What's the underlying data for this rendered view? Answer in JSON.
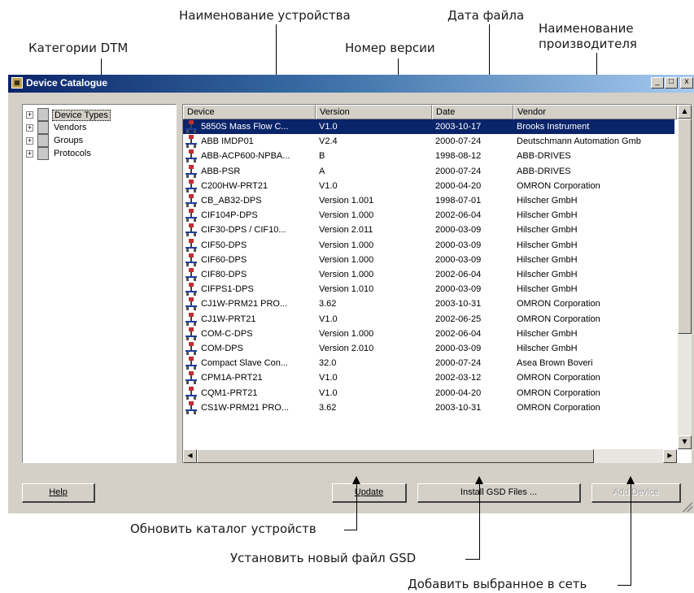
{
  "callouts": {
    "device_name": "Наименование устройства",
    "file_date": "Дата файла",
    "manufacturer_line1": "Наименование",
    "manufacturer_line2": "производителя",
    "dtm_categories": "Категории DTM",
    "version_number": "Номер версии",
    "update_catalog": "Обновить каталог устройств",
    "install_gsd": "Установить новый файл GSD",
    "add_selected": "Добавить выбранное в сеть"
  },
  "window": {
    "title": "Device Catalogue",
    "minimize": "_",
    "maximize": "□",
    "close": "x"
  },
  "tree": {
    "items": [
      {
        "label": "Device Types",
        "expander": "+"
      },
      {
        "label": "Vendors",
        "expander": "+"
      },
      {
        "label": "Groups",
        "expander": "+"
      },
      {
        "label": "Protocols",
        "expander": "+"
      }
    ]
  },
  "table": {
    "columns": [
      "Device",
      "Version",
      "Date",
      "Vendor"
    ],
    "rows": [
      {
        "device": "5850S Mass Flow C...",
        "version": "V1.0",
        "date": "2003-10-17",
        "vendor": "Brooks Instrument"
      },
      {
        "device": "ABB IMDP01",
        "version": "V2.4",
        "date": "2000-07-24",
        "vendor": "Deutschmann Automation Gmb"
      },
      {
        "device": "ABB-ACP600-NPBA...",
        "version": "B",
        "date": "1998-08-12",
        "vendor": "ABB-DRIVES"
      },
      {
        "device": "ABB-PSR",
        "version": "A",
        "date": "2000-07-24",
        "vendor": "ABB-DRIVES"
      },
      {
        "device": "C200HW-PRT21",
        "version": "V1.0",
        "date": "2000-04-20",
        "vendor": "OMRON Corporation"
      },
      {
        "device": "CB_AB32-DPS",
        "version": "Version 1.001",
        "date": "1998-07-01",
        "vendor": "Hilscher GmbH"
      },
      {
        "device": "CIF104P-DPS",
        "version": "Version 1.000",
        "date": "2002-06-04",
        "vendor": "Hilscher GmbH"
      },
      {
        "device": "CIF30-DPS / CIF10...",
        "version": "Version 2.011",
        "date": "2000-03-09",
        "vendor": "Hilscher GmbH"
      },
      {
        "device": "CIF50-DPS",
        "version": "Version 1.000",
        "date": "2000-03-09",
        "vendor": "Hilscher GmbH"
      },
      {
        "device": "CIF60-DPS",
        "version": "Version 1.000",
        "date": "2000-03-09",
        "vendor": "Hilscher GmbH"
      },
      {
        "device": "CIF80-DPS",
        "version": "Version 1.000",
        "date": "2002-06-04",
        "vendor": "Hilscher GmbH"
      },
      {
        "device": "CIFPS1-DPS",
        "version": "Version 1.010",
        "date": "2000-03-09",
        "vendor": "Hilscher GmbH"
      },
      {
        "device": "CJ1W-PRM21 PRO...",
        "version": "3.62",
        "date": "2003-10-31",
        "vendor": "OMRON Corporation"
      },
      {
        "device": "CJ1W-PRT21",
        "version": "V1.0",
        "date": "2002-06-25",
        "vendor": "OMRON Corporation"
      },
      {
        "device": "COM-C-DPS",
        "version": "Version 1.000",
        "date": "2002-06-04",
        "vendor": "Hilscher GmbH"
      },
      {
        "device": "COM-DPS",
        "version": "Version 2.010",
        "date": "2000-03-09",
        "vendor": "Hilscher GmbH"
      },
      {
        "device": "Compact Slave Con...",
        "version": "32.0",
        "date": "2000-07-24",
        "vendor": "Asea Brown Boveri"
      },
      {
        "device": "CPM1A-PRT21",
        "version": "V1.0",
        "date": "2002-03-12",
        "vendor": "OMRON Corporation"
      },
      {
        "device": "CQM1-PRT21",
        "version": "V1.0",
        "date": "2000-04-20",
        "vendor": "OMRON Corporation"
      },
      {
        "device": "CS1W-PRM21 PRO...",
        "version": "3.62",
        "date": "2003-10-31",
        "vendor": "OMRON Corporation"
      }
    ],
    "selected_row": 0
  },
  "buttons": {
    "help": "Help",
    "update": "Update",
    "install_gsd": "Install GSD Files ...",
    "add_device": "Add Device"
  },
  "colors": {
    "selection": "#0a246a",
    "title_gradient_start": "#0a246a",
    "title_gradient_end": "#a6caf0",
    "face": "#d4d0c8"
  }
}
